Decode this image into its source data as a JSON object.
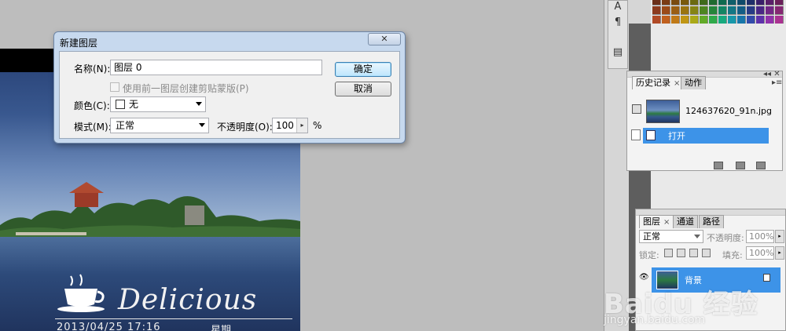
{
  "dialog": {
    "title": "新建图层",
    "close_glyph": "✕",
    "name_label": "名称(N):",
    "name_value": "图层 0",
    "clip_mask_label": "使用前一图层创建剪贴蒙版(P)",
    "color_label": "颜色(C):",
    "color_value": "无",
    "mode_label": "模式(M):",
    "mode_value": "正常",
    "opacity_label": "不透明度(O):",
    "opacity_value": "100",
    "opacity_unit": "%",
    "ok_label": "确定",
    "cancel_label": "取消"
  },
  "canvas": {
    "brand_text": "Delicious",
    "date_text": "2013/04/25 17:16",
    "weekday_text": "星期"
  },
  "tools": {
    "char_glyph": "A",
    "para_glyph": "¶"
  },
  "history_panel": {
    "tab_history": "历史记录",
    "tab_actions": "动作",
    "tab_close": "×",
    "snapshot_file": "124637620_91n.jpg",
    "step_open": "打开",
    "menu_glyph": "▸≡",
    "collapse_glyph": "◂◂ ✕"
  },
  "layers_panel": {
    "tab_layers": "图层",
    "tab_channels": "通道",
    "tab_paths": "路径",
    "tab_close": "×",
    "mode_value": "正常",
    "opacity_label": "不透明度:",
    "opacity_value": "100%",
    "lock_label": "锁定:",
    "fill_label": "填充:",
    "fill_value": "100%",
    "layer_name": "背景",
    "eye_glyph": "👁"
  },
  "watermark": {
    "top": "Baidu 经验",
    "bottom": "jingyan.baidu.com"
  },
  "colors": {
    "dialog_frame": "#c7d9ee",
    "selection": "#3d93e8",
    "workspace": "#bdbdbd"
  }
}
